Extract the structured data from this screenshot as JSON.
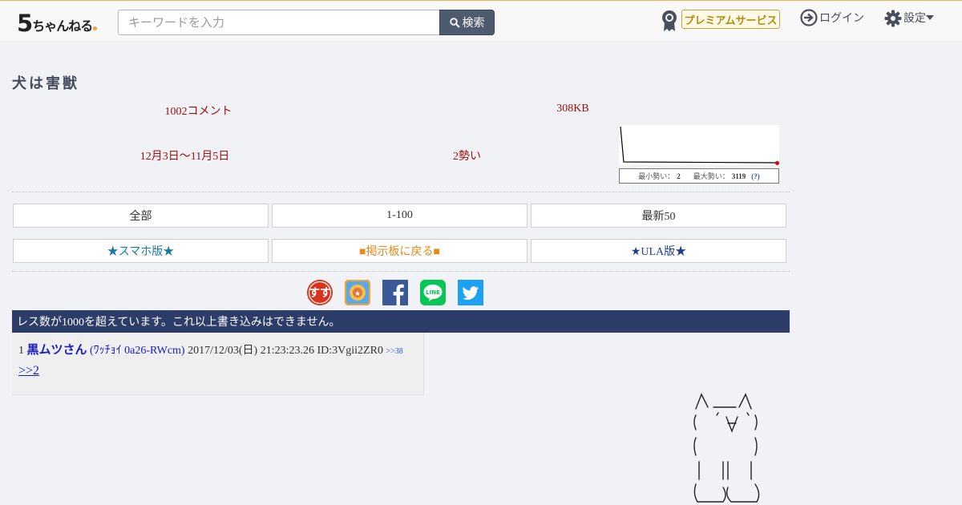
{
  "header": {
    "logo": {
      "five": "5",
      "kana": "ちゃんねる"
    },
    "search": {
      "placeholder": "キーワードを入力",
      "button_label": "検索"
    },
    "premium_label": "プレミアムサービス",
    "login_label": "ログイン",
    "settings_label": "設定"
  },
  "thread": {
    "title": "犬は害獣",
    "comments": "1002コメント",
    "size": "308KB",
    "dates": "12月3日〜11月5日",
    "momentum": "2勢い",
    "graph": {
      "min_label": "最小勢い：",
      "min_value": "2",
      "max_label": "最大勢い：",
      "max_value": "3119",
      "help": "(?)",
      "line_color": "#000000",
      "marker_color": "#dd0000"
    }
  },
  "nav": {
    "row1": [
      {
        "label": "全部",
        "color": "#333333"
      },
      {
        "label": "1-100",
        "color": "#333333"
      },
      {
        "label": "最新50",
        "color": "#333333"
      }
    ],
    "row2": [
      {
        "label": "★スマホ版★",
        "color": "#1a7aa0"
      },
      {
        "label": "■掲示板に戻る■",
        "color": "#e6891a"
      },
      {
        "label": "★ULA版★",
        "color": "#1f3f8a"
      }
    ]
  },
  "share": [
    {
      "icon": "susu-icon",
      "color": "#d9331e"
    },
    {
      "icon": "hatena-bookmark-icon",
      "color": "#f2a33a"
    },
    {
      "icon": "facebook-icon",
      "color": "#3b5998"
    },
    {
      "icon": "line-icon",
      "color": "#06c755"
    },
    {
      "icon": "twitter-icon",
      "color": "#1da1f2"
    }
  ],
  "notice": "レス数が1000を超えています。これ以上書き込みはできません。",
  "posts": [
    {
      "number": "1",
      "name": "黒ムツさん",
      "trip": "(ﾜｯﾁｮｲ 0a26-RWcm)",
      "date": "2017/12/03(日) 21:23:23.26",
      "id": "ID:3Vgii2ZR0",
      "reply_ref": ">>38",
      "body": ">>2"
    }
  ]
}
